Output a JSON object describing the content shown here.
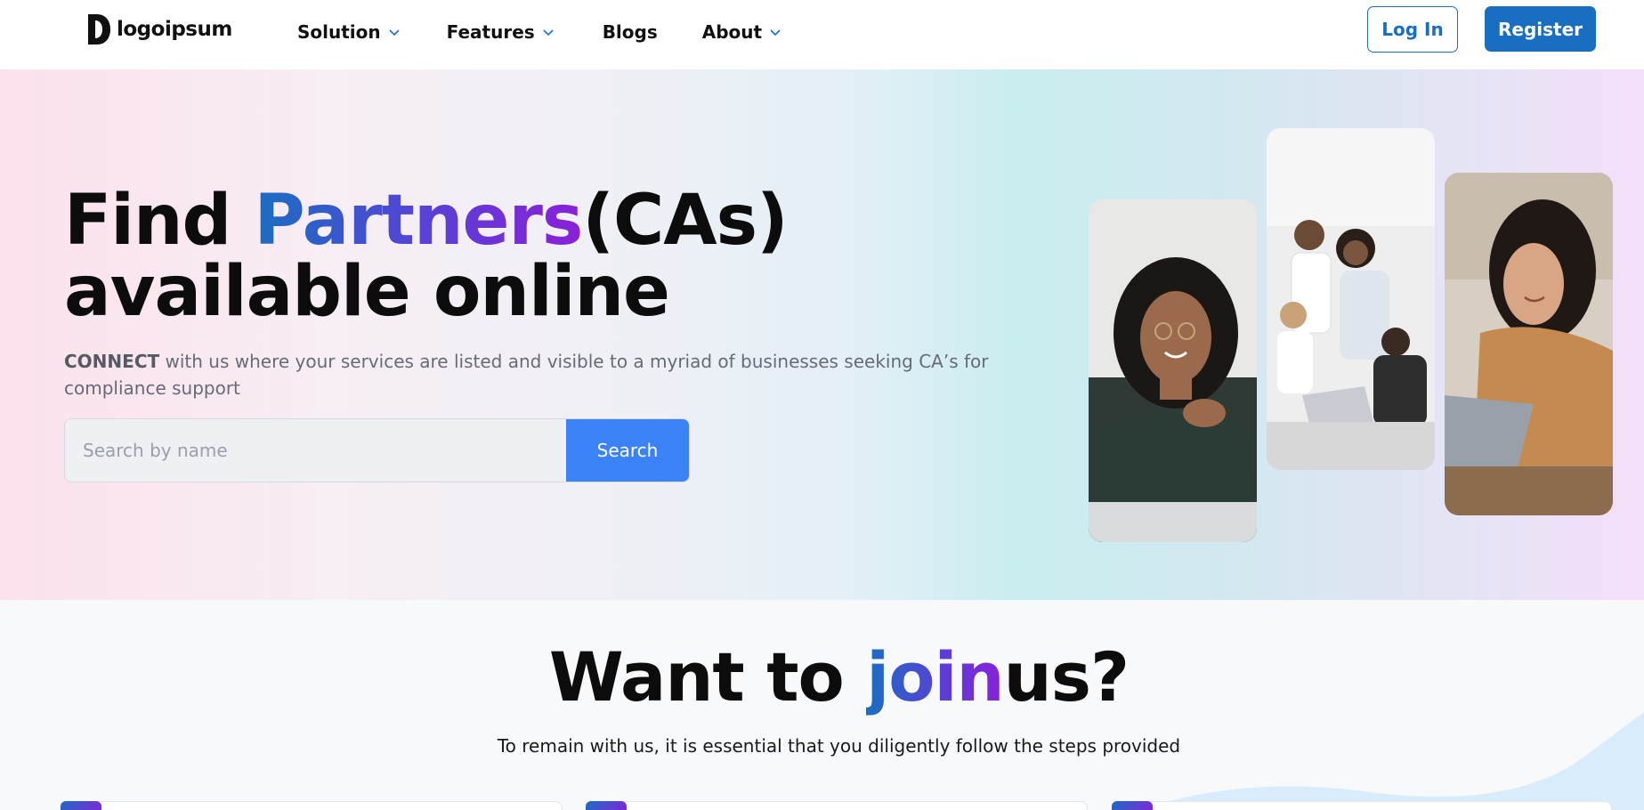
{
  "nav": {
    "logo_text": "logoipsum",
    "menu": [
      {
        "label": "Solution",
        "has_dropdown": true
      },
      {
        "label": "Features",
        "has_dropdown": true
      },
      {
        "label": "Blogs",
        "has_dropdown": false
      },
      {
        "label": "About",
        "has_dropdown": true
      }
    ],
    "login_label": "Log In",
    "register_label": "Register"
  },
  "hero": {
    "title_part1": "Find ",
    "title_highlight": "Partners",
    "title_part2": "(CAs)",
    "title_line2": "available online",
    "subtitle_bold": "CONNECT",
    "subtitle_rest": " with us where your services are listed and visible to a myriad of businesses seeking CA’s for compliance support",
    "search_placeholder": "Search by name",
    "search_button": "Search"
  },
  "join": {
    "title_part1": "Want to ",
    "title_highlight": "join",
    "title_part2": "us?",
    "subtitle": "To remain with us, it is essential that you diligently follow the steps provided"
  },
  "colors": {
    "brand_blue": "#1a6ec2",
    "search_button": "#3b82f6",
    "accent_purple": "#8a20d8"
  }
}
